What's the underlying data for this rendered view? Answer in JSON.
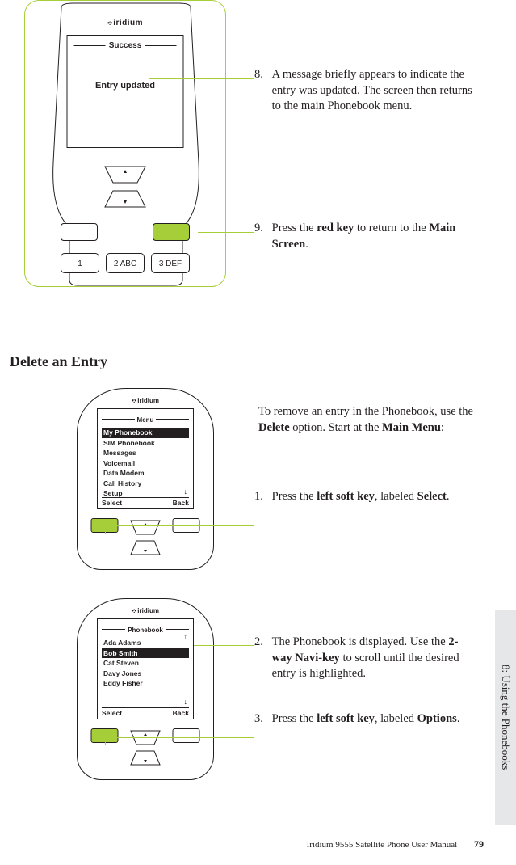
{
  "phone1": {
    "brand": "iridium",
    "screen_title": "Success",
    "screen_message": "Entry updated",
    "key1": "1",
    "key2": "2 ABC",
    "key3": "3 DEF"
  },
  "step8": {
    "num": "8.",
    "text": "A message briefly appears to indicate the entry was updated. The screen then returns to the main Phonebook menu."
  },
  "step9": {
    "num": "9.",
    "text_before": "Press the ",
    "bold1": "red key",
    "text_mid": " to return to the ",
    "bold2": "Main Screen",
    "text_after": "."
  },
  "section_heading": "Delete an Entry",
  "phone2": {
    "brand": "iridium",
    "screen_title": "Menu",
    "items": [
      "My Phonebook",
      "SIM Phonebook",
      "Messages",
      "Voicemail",
      "Data Modem",
      "Call History",
      "Setup"
    ],
    "selected_index": 0,
    "soft_left": "Select",
    "soft_right": "Back"
  },
  "intro2": {
    "text_before": "To remove an entry in the Phonebook, use the ",
    "bold1": "Delete",
    "text_mid": " option. Start at the ",
    "bold2": "Main Menu",
    "text_after": ":"
  },
  "step1": {
    "num": "1.",
    "text_before": "Press the ",
    "bold1": "left soft key",
    "text_mid": ", labeled ",
    "bold2": "Select",
    "text_after": "."
  },
  "phone3": {
    "brand": "iridium",
    "screen_title": "Phonebook",
    "items": [
      "Ada Adams",
      "Bob Smith",
      "Cat Steven",
      "Davy Jones",
      "Eddy Fisher"
    ],
    "selected_index": 1,
    "soft_left": "Select",
    "soft_right": "Back"
  },
  "step2": {
    "num": "2.",
    "text_before": "The Phonebook is displayed. Use the ",
    "bold1": "2-way Navi-key",
    "text_mid": " to scroll until the desired entry is highlighted."
  },
  "step3": {
    "num": "3.",
    "text_before": "Press the ",
    "bold1": "left soft key",
    "text_mid": ", labeled ",
    "bold2": "Options",
    "text_after": "."
  },
  "sidetab": "8: Using the Phonebooks",
  "footer": {
    "text": "Iridium 9555 Satellite Phone User Manual",
    "page": "79"
  }
}
